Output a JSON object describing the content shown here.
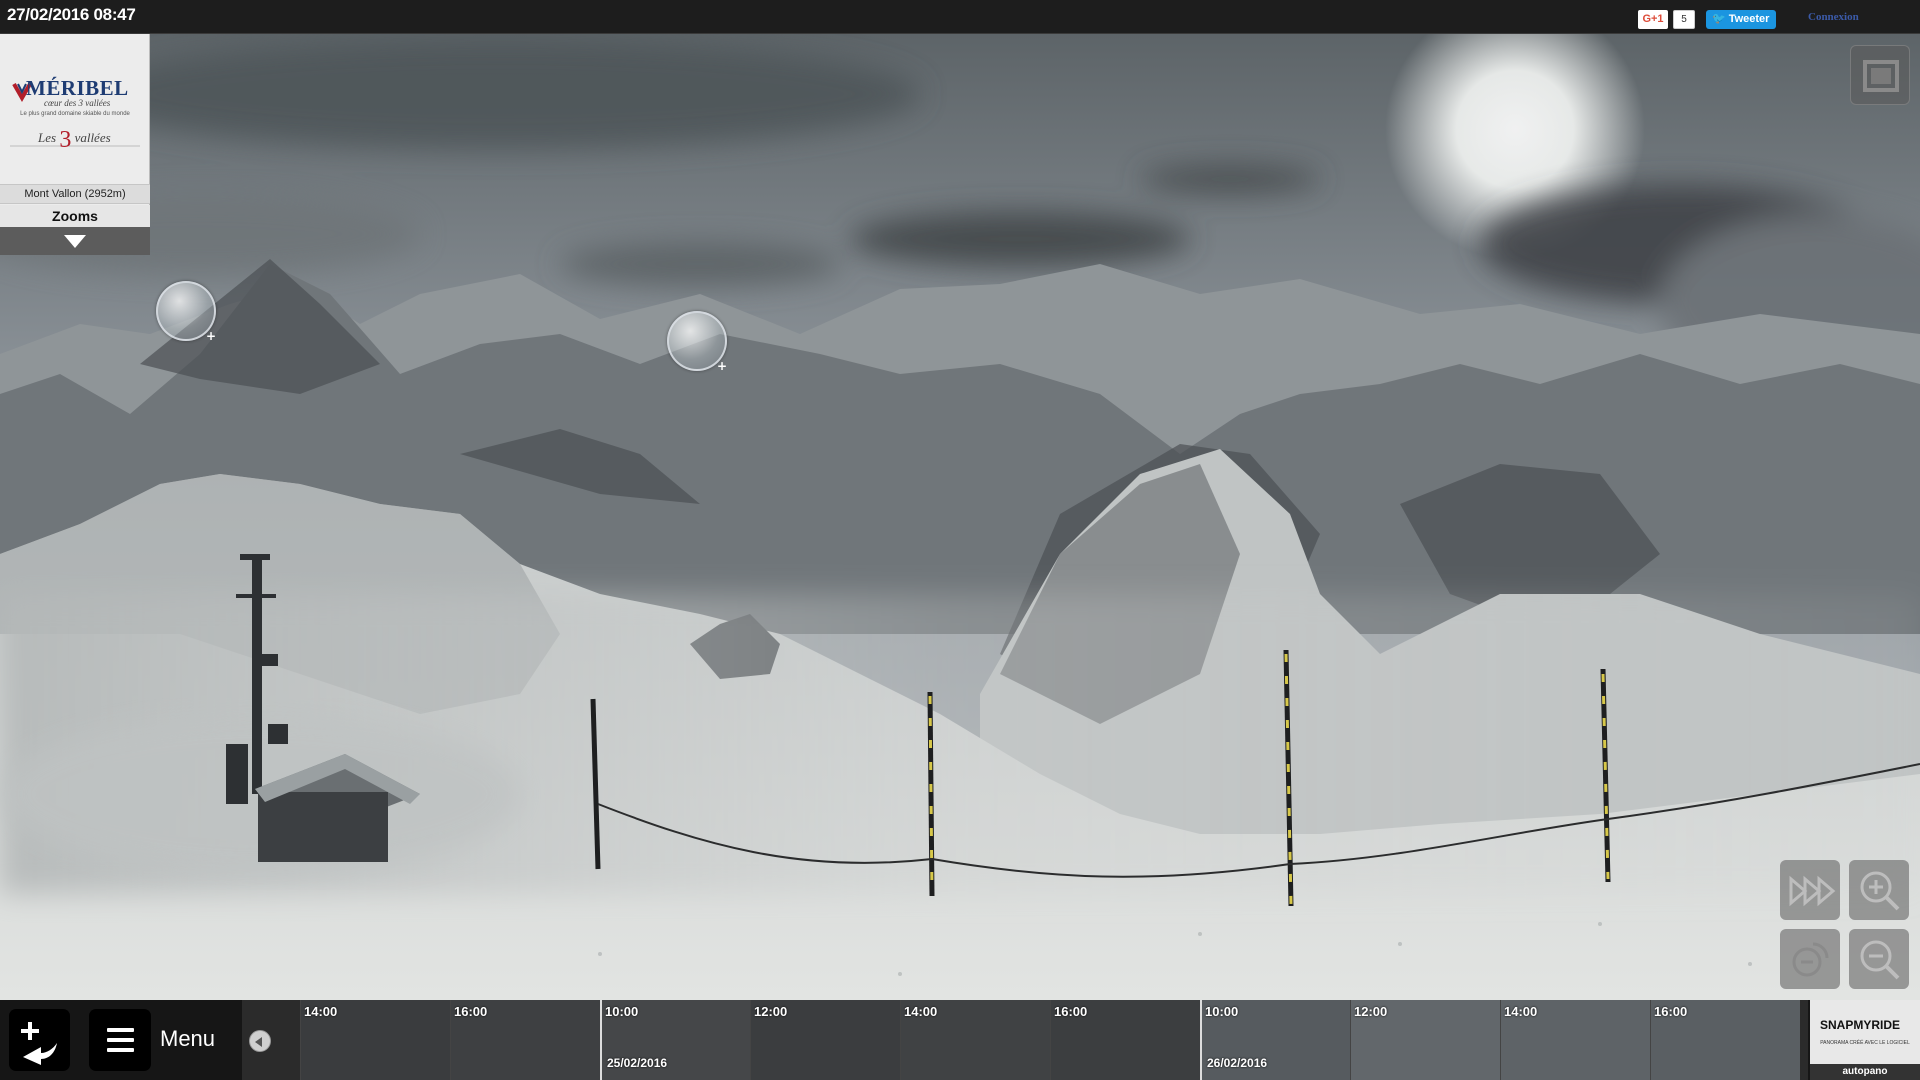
{
  "header": {
    "timestamp": "27/02/2016 08:47",
    "gplus_label": "G+1",
    "gplus_count": "5",
    "tweet_label": "Tweeter",
    "login_label": "Connexion"
  },
  "brand": {
    "name": "MÉRIBEL",
    "tagline": "cœur des 3 vallées",
    "slogan": "Le plus grand domaine skiable du monde",
    "mark_prefix": "Les",
    "mark_number": "3",
    "mark_suffix": "vallées",
    "location": "Mont Vallon (2952m)",
    "zooms_label": "Zooms"
  },
  "controls": {
    "fullscreen_icon": "fullscreen-icon",
    "autoplay_icon": "fast-forward-icon",
    "zoom_in_icon": "zoom-in-icon",
    "zoom_reset_icon": "zoom-reset-icon",
    "zoom_out_icon": "zoom-out-icon"
  },
  "bottom": {
    "menu_label": "Menu",
    "timeline": [
      {
        "time": "14:00",
        "date": ""
      },
      {
        "time": "16:00",
        "date": ""
      },
      {
        "time": "10:00",
        "date": "25/02/2016"
      },
      {
        "time": "12:00",
        "date": ""
      },
      {
        "time": "14:00",
        "date": ""
      },
      {
        "time": "16:00",
        "date": ""
      },
      {
        "time": "10:00",
        "date": "26/02/2016"
      },
      {
        "time": "12:00",
        "date": ""
      },
      {
        "time": "14:00",
        "date": ""
      },
      {
        "time": "16:00",
        "date": ""
      }
    ]
  },
  "sponsor": {
    "title": "SNAPMYRIDE",
    "subtitle": "PANORAMA CRÉÉ AVEC LE LOGICIEL",
    "footer": "autopano"
  },
  "colors": {
    "topbar": "#1d1d1d",
    "tweet": "#1b95e0",
    "gplus": "#dd4b39",
    "brand_blue": "#1e3c73",
    "brand_red": "#b21e2a"
  }
}
